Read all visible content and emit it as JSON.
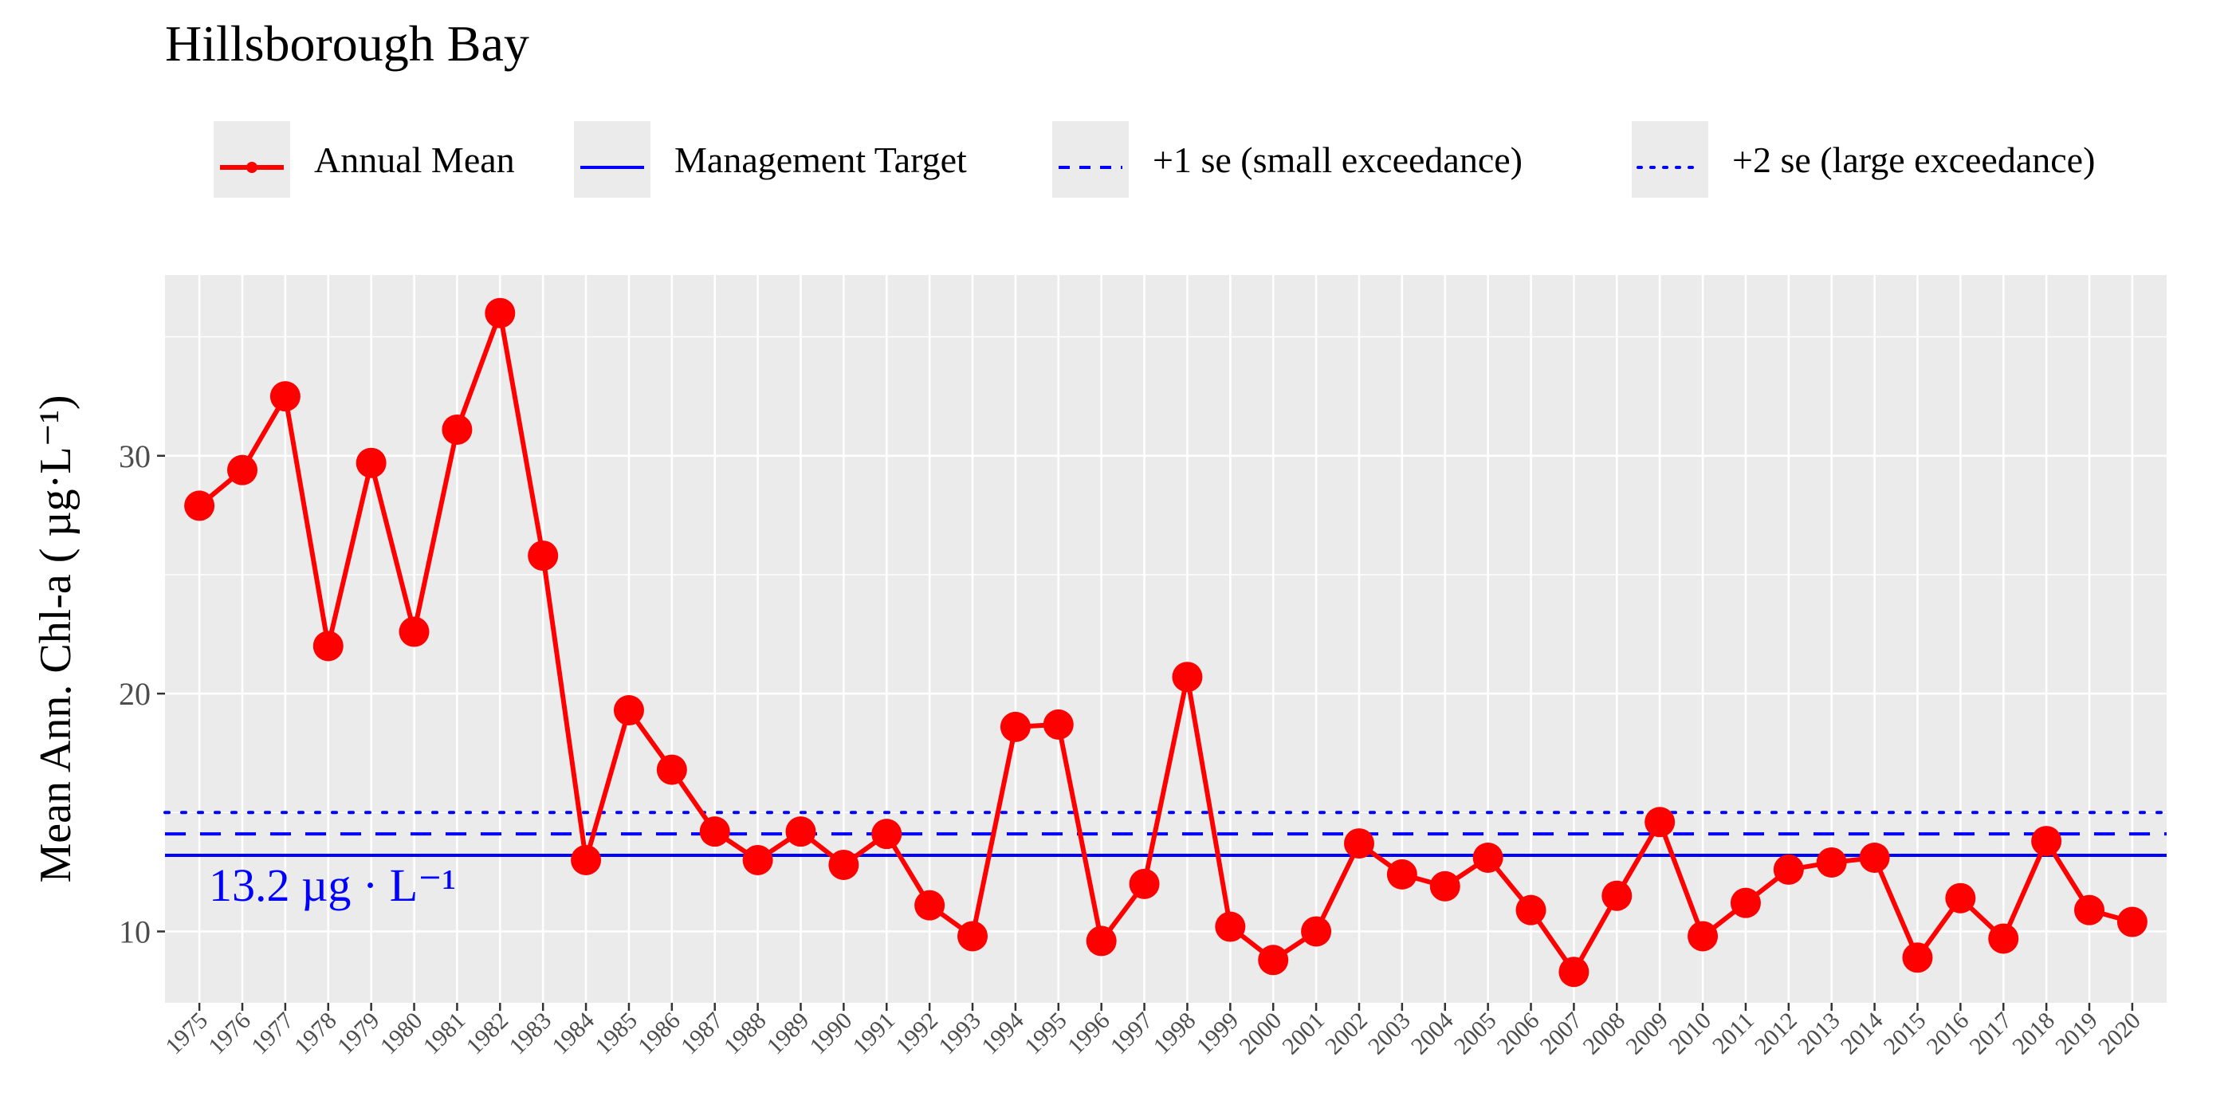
{
  "title": "Hillsborough Bay",
  "colors": {
    "series": "#ff0000",
    "target": "#0000ff",
    "panel": "#ebebeb",
    "grid": "#ffffff"
  },
  "legend": {
    "items": [
      {
        "label": "Annual Mean",
        "style": "line-point"
      },
      {
        "label": "Management Target",
        "style": "solid"
      },
      {
        "label": "+1 se (small exceedance)",
        "style": "dashed"
      },
      {
        "label": "+2 se (large exceedance)",
        "style": "dotted"
      }
    ]
  },
  "chart_data": {
    "type": "line",
    "title": "Hillsborough Bay",
    "ylabel": "Mean Ann. Chl-a ( µg·L⁻¹)",
    "xlabel": "",
    "ylim": [
      7,
      37.6
    ],
    "yticks": [
      10,
      20,
      30
    ],
    "grid": true,
    "legend_position": "top",
    "x": [
      "1975",
      "1976",
      "1977",
      "1978",
      "1979",
      "1980",
      "1981",
      "1982",
      "1983",
      "1984",
      "1985",
      "1986",
      "1987",
      "1988",
      "1989",
      "1990",
      "1991",
      "1992",
      "1993",
      "1994",
      "1995",
      "1996",
      "1997",
      "1998",
      "1999",
      "2000",
      "2001",
      "2002",
      "2003",
      "2004",
      "2005",
      "2006",
      "2007",
      "2008",
      "2009",
      "2010",
      "2011",
      "2012",
      "2013",
      "2014",
      "2015",
      "2016",
      "2017",
      "2018",
      "2019",
      "2020"
    ],
    "series": [
      {
        "name": "Annual Mean",
        "values": [
          27.9,
          29.4,
          32.5,
          22.0,
          29.7,
          22.6,
          31.1,
          36.0,
          25.8,
          13.0,
          19.3,
          16.8,
          14.2,
          13.0,
          14.2,
          12.8,
          14.1,
          11.1,
          9.8,
          18.6,
          18.7,
          9.6,
          12.0,
          20.7,
          10.2,
          8.8,
          10.0,
          13.7,
          12.4,
          11.9,
          13.1,
          10.9,
          8.3,
          11.5,
          14.6,
          9.8,
          11.2,
          12.6,
          12.9,
          13.1,
          8.9,
          11.4,
          9.7,
          13.8,
          10.9,
          10.4
        ]
      }
    ],
    "reference_lines": [
      {
        "name": "Management Target",
        "value": 13.2,
        "style": "solid"
      },
      {
        "name": "+1 se (small exceedance)",
        "value": 14.1,
        "style": "dashed"
      },
      {
        "name": "+2 se (large exceedance)",
        "value": 15.0,
        "style": "dotted"
      }
    ],
    "annotation": "13.2 µg · L⁻¹"
  }
}
